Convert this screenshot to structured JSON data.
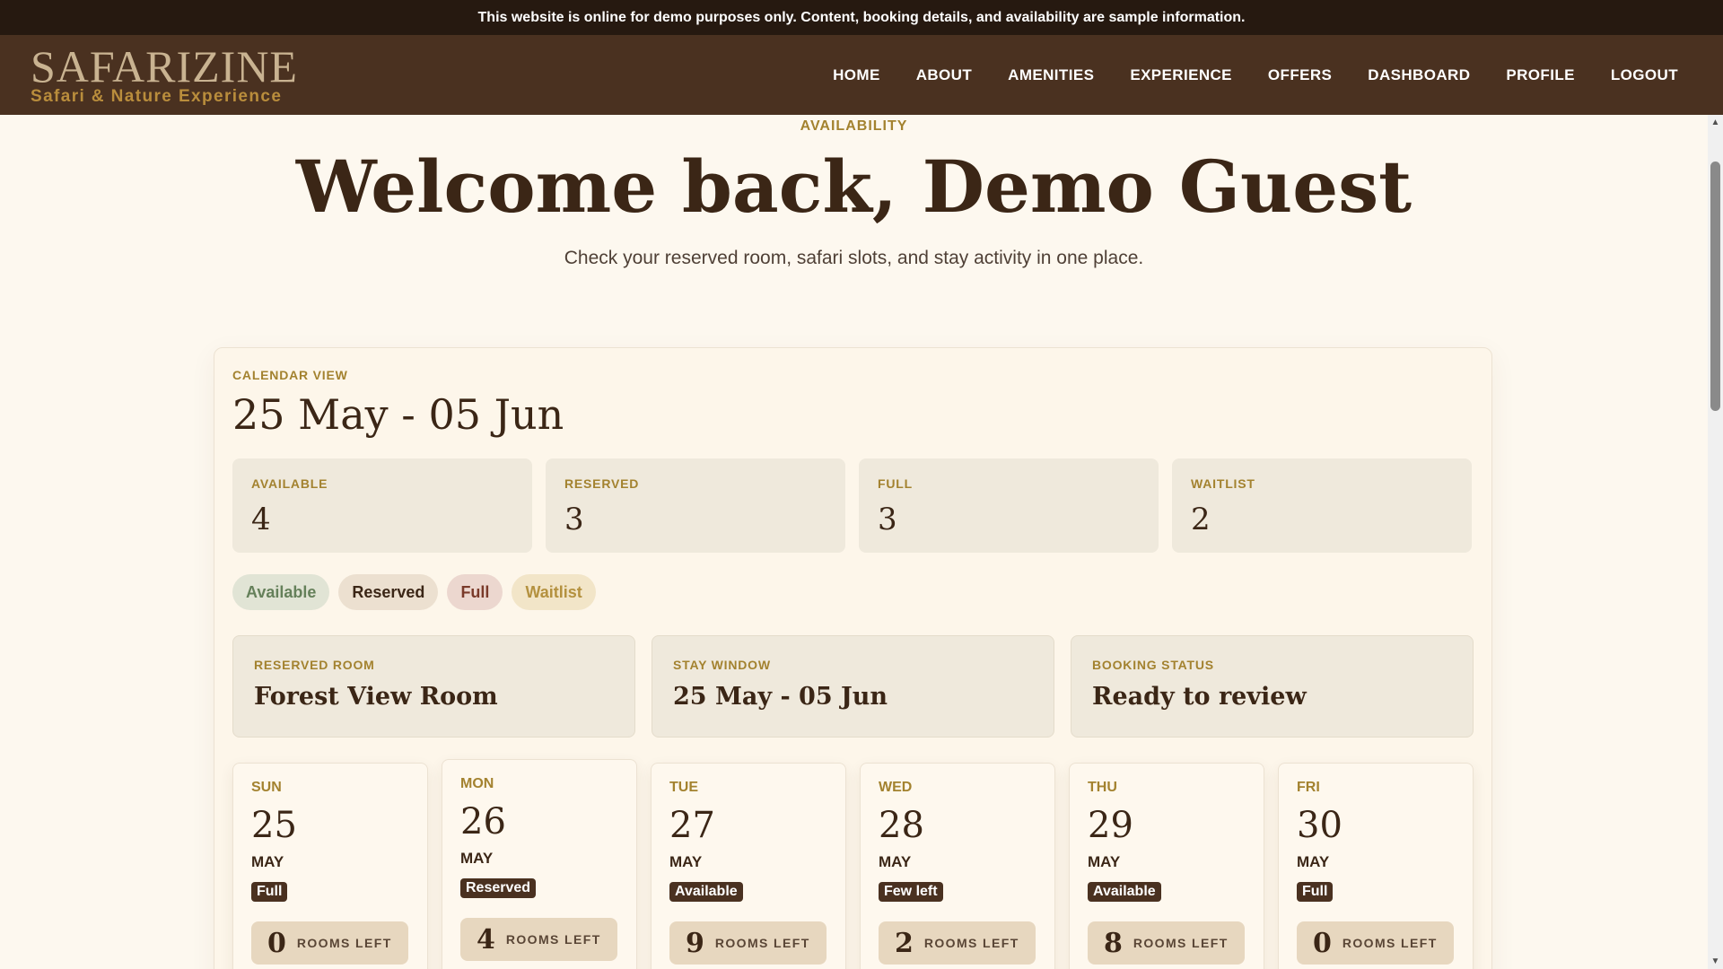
{
  "notice": "This website is online for demo purposes only. Content, booking details, and availability are sample information.",
  "brand": {
    "name": "SAFARIZINE",
    "tagline": "Safari & Nature Experience"
  },
  "nav": [
    "HOME",
    "ABOUT",
    "AMENITIES",
    "EXPERIENCE",
    "OFFERS",
    "DASHBOARD",
    "PROFILE",
    "LOGOUT"
  ],
  "hero": {
    "eyebrow": "AVAILABILITY",
    "title": "Welcome back, Demo Guest",
    "subtitle": "Check your reserved room, safari slots, and stay activity in one place."
  },
  "calendar": {
    "eyebrow": "CALENDAR VIEW",
    "range": "25 May - 05 Jun",
    "stats": [
      {
        "label": "AVAILABLE",
        "value": "4"
      },
      {
        "label": "RESERVED",
        "value": "3"
      },
      {
        "label": "FULL",
        "value": "3"
      },
      {
        "label": "WAITLIST",
        "value": "2"
      }
    ],
    "legend": [
      "Available",
      "Reserved",
      "Full",
      "Waitlist"
    ],
    "info": [
      {
        "label": "RESERVED ROOM",
        "value": "Forest View Room"
      },
      {
        "label": "STAY WINDOW",
        "value": "25 May - 05 Jun"
      },
      {
        "label": "BOOKING STATUS",
        "value": "Ready to review"
      }
    ],
    "rooms_left_label": "ROOMS LEFT",
    "days": [
      {
        "day": "SUN",
        "date": "25",
        "month": "MAY",
        "status": "Full",
        "rooms": "0"
      },
      {
        "day": "MON",
        "date": "26",
        "month": "MAY",
        "status": "Reserved",
        "rooms": "4"
      },
      {
        "day": "TUE",
        "date": "27",
        "month": "MAY",
        "status": "Available",
        "rooms": "9"
      },
      {
        "day": "WED",
        "date": "28",
        "month": "MAY",
        "status": "Few left",
        "rooms": "2"
      },
      {
        "day": "THU",
        "date": "29",
        "month": "MAY",
        "status": "Available",
        "rooms": "8"
      },
      {
        "day": "FRI",
        "date": "30",
        "month": "MAY",
        "status": "Full",
        "rooms": "0"
      }
    ]
  },
  "colors": {
    "header_bg": "#4a3120",
    "notice_bg": "#261910",
    "accent_gold": "#a3822f",
    "page_bg": "#fdf8ef",
    "text_dark": "#3b2616"
  }
}
